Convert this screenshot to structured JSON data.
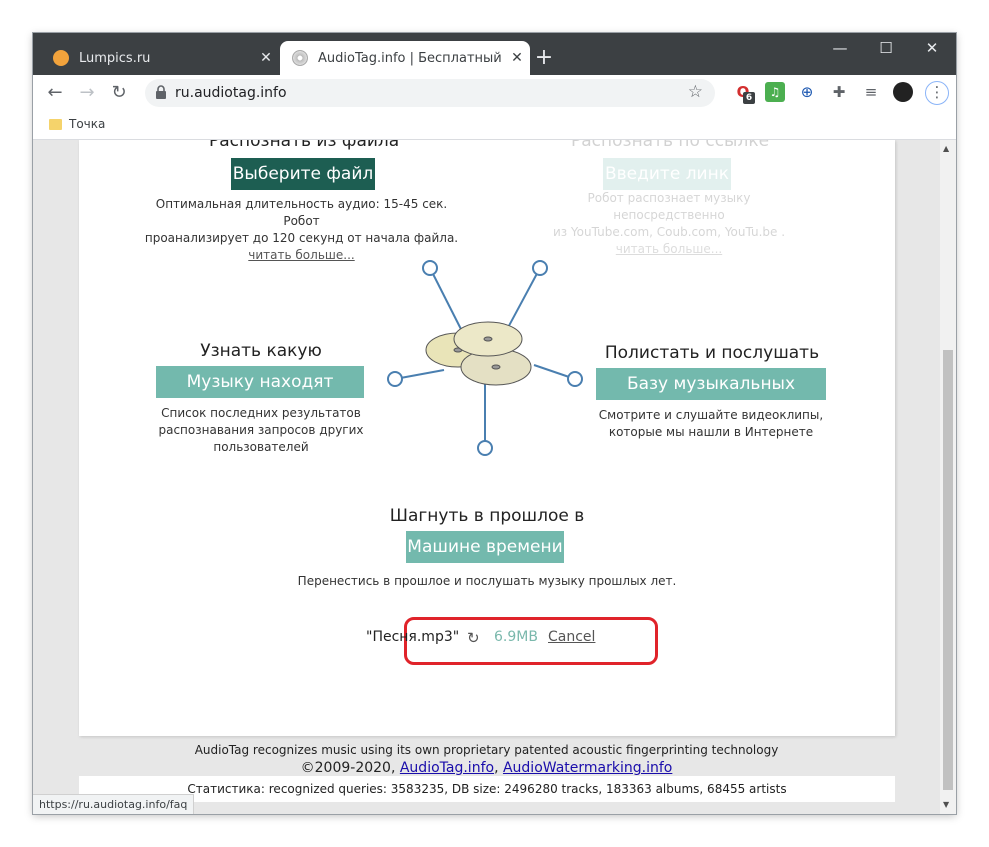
{
  "tabs": [
    {
      "label": "Lumpics.ru",
      "favicon_color": "#f2a33c",
      "active": false
    },
    {
      "label": "AudioTag.info | Бесплатный роб",
      "favicon_color": "#b8b8b8",
      "active": true
    }
  ],
  "window_controls": {
    "minimize": "—",
    "maximize": "☐",
    "close": "✕"
  },
  "toolbar": {
    "url": "ru.audiotag.info",
    "extension_badge": "6",
    "extensions": [
      "opera-extension-icon",
      "music-extension-icon",
      "globe-extension-icon",
      "puzzle-icon",
      "media-control-icon",
      "profile-avatar"
    ]
  },
  "bookmarks": [
    {
      "label": "Точка"
    }
  ],
  "sections": {
    "from_file": {
      "heading": "Распознать из файла",
      "button": "Выберите файл",
      "desc_line1": "Оптимальная длительность аудио: 15-45 сек. Робот",
      "desc_line2": "проанализирует до 120 секунд от начала файла.",
      "more": "читать больше..."
    },
    "from_link": {
      "heading": "Распознать по ссылке",
      "button": "Введите линк",
      "desc_line1": "Робот распознает музыку непосредственно",
      "desc_line2": "из YouTube.com, Coub.com, YouTu.be .",
      "more": "читать больше..."
    },
    "others": {
      "heading": "Узнать какую",
      "button": "Музыку находят другие",
      "desc_line1": "Список последних результатов",
      "desc_line2": "распознавания запросов других",
      "desc_line3": "пользователей"
    },
    "clips": {
      "heading": "Полистать и послушать",
      "button": "Базу музыкальных клипов",
      "desc_line1": "Смотрите и слушайте видеоклипы,",
      "desc_line2": "которые мы нашли в Интернете"
    },
    "time_machine": {
      "heading": "Шагнуть в прошлое в",
      "button": "Машине времени",
      "desc": "Перенестись в прошлое и послушать музыку прошлых лет."
    }
  },
  "upload": {
    "filename": "\"Песня.mp3\"",
    "size": "6.9MB",
    "cancel": "Cancel"
  },
  "footer": {
    "line1": "AudioTag recognizes music using its own proprietary patented acoustic fingerprinting technology",
    "copyright": "©2009-2020,",
    "link1": "AudioTag.info",
    "sep": ",",
    "link2": "AudioWatermarking.info",
    "stats": "Статистика: recognized queries: 3583235, DB size: 2496280 tracks, 183363 albums, 68455 artists"
  },
  "status_url": "https://ru.audiotag.info/faq",
  "colors": {
    "accent_dark": "#1d5e52",
    "accent_teal": "#73b9ad",
    "highlight": "#e0232a"
  }
}
